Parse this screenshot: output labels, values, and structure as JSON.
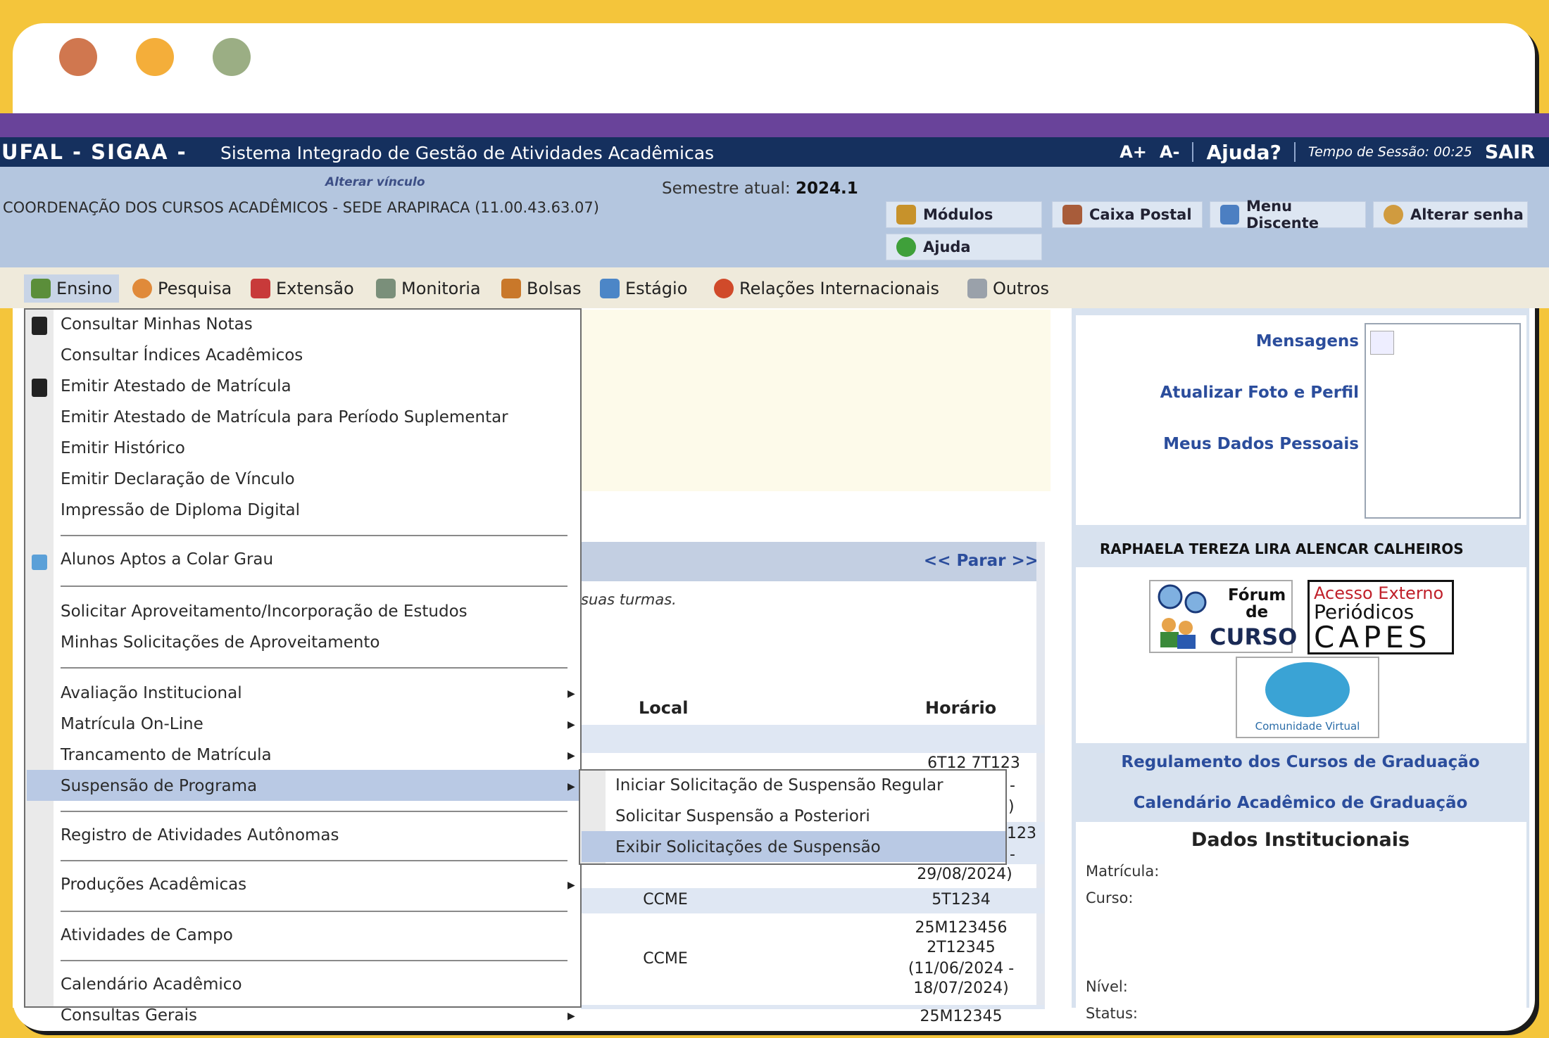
{
  "header": {
    "system_short": "UFAL - SIGAA -",
    "system_name": "Sistema Integrado de Gestão de Atividades Acadêmicas",
    "font_plus": "A+",
    "font_minus": "A-",
    "help": "Ajuda?",
    "session": "Tempo de Sessão: 00:25",
    "logout": "SAIR"
  },
  "info": {
    "change_link": "Alterar vínculo",
    "unit": "COORDENAÇÃO DOS CURSOS ACADÊMICOS - SEDE ARAPIRACA (11.00.43.63.07)",
    "semester_label": "Semestre atual:",
    "semester_value": "2024.1",
    "buttons": {
      "modulos": "Módulos",
      "caixa": "Caixa Postal",
      "menu_discente": "Menu Discente",
      "alterar_senha": "Alterar senha",
      "ajuda": "Ajuda"
    }
  },
  "menubar": [
    "Ensino",
    "Pesquisa",
    "Extensão",
    "Monitoria",
    "Bolsas",
    "Estágio",
    "Relações Internacionais",
    "Outros"
  ],
  "dropdown": [
    "Consultar Minhas Notas",
    "Consultar Índices Acadêmicos",
    "Emitir Atestado de Matrícula",
    "Emitir Atestado de Matrícula para Período Suplementar",
    "Emitir Histórico",
    "Emitir Declaração de Vínculo",
    "Impressão de Diploma Digital",
    "Alunos Aptos a Colar Grau",
    "Solicitar Aproveitamento/Incorporação de Estudos",
    "Minhas Solicitações de Aproveitamento",
    "Avaliação Institucional",
    "Matrícula On-Line",
    "Trancamento de Matrícula",
    "Suspensão de Programa",
    "Registro de Atividades Autônomas",
    "Produções Acadêmicas",
    "Atividades de Campo",
    "Calendário Acadêmico",
    "Consultas Gerais"
  ],
  "submenu": [
    "Iniciar Solicitação de Suspensão Regular",
    "Solicitar Suspensão a Posteriori",
    "Exibir Solicitações de Suspensão"
  ],
  "content": {
    "nav": "<< Parar >>",
    "hint": "suas turmas.",
    "col_local": "Local",
    "col_horario": "Horário",
    "rows": {
      "r1_h": "6T12 7T123",
      "r1_dash": "-",
      "r1_paren": ")",
      "r2_h": "123",
      "r2_dash": "-",
      "r2_end": "29/08/2024)",
      "r3_local": "CCME",
      "r3_h": "5T1234",
      "r4_local": "CCME",
      "r4_h1": "25M123456",
      "r4_h2": "2T12345",
      "r4_h3": "(11/06/2024 -",
      "r4_h4": "18/07/2024)",
      "r5_h": "25M12345"
    }
  },
  "sidebar": {
    "mensagens": "Mensagens",
    "atualizar": "Atualizar Foto e Perfil",
    "dados": "Meus Dados Pessoais",
    "student_name": "RAPHAELA TEREZA LIRA ALENCAR CALHEIROS",
    "forum_line1": "Fórum",
    "forum_line2": "de",
    "forum_line3": "CURSO",
    "capes_line1": "Acesso Externo",
    "capes_line2": "Periódicos",
    "capes_line3": "CAPES",
    "comunidade": "Comunidade Virtual",
    "regulamento": "Regulamento dos Cursos de Graduação",
    "calendario": "Calendário Acadêmico de Graduação",
    "dados_title": "Dados Institucionais",
    "matricula": "Matrícula:",
    "curso": "Curso:",
    "nivel": "Nível:",
    "status": "Status:"
  }
}
